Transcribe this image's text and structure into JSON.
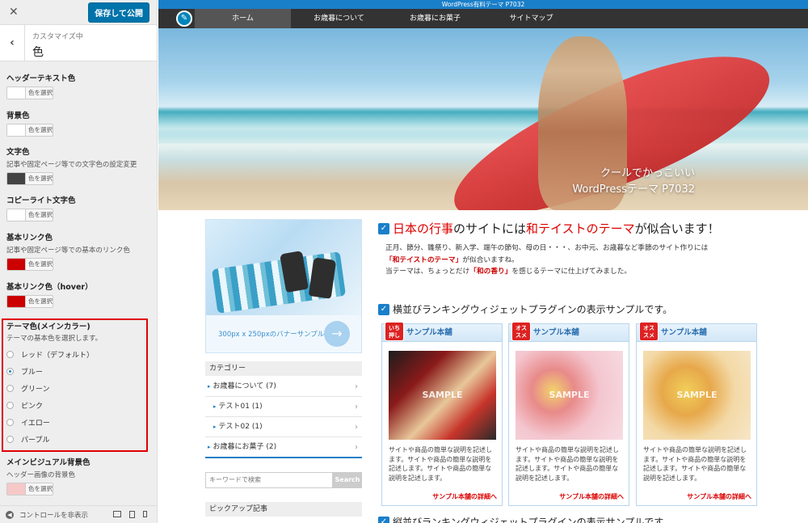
{
  "sidebar": {
    "close_icon": "close-icon",
    "save_label": "保存して公開",
    "breadcrumb": "カスタマイズ中",
    "title": "色",
    "sections": [
      {
        "label": "ヘッダーテキスト色",
        "desc": "",
        "button": "色を選択",
        "color": "#ffffff"
      },
      {
        "label": "背景色",
        "desc": "",
        "button": "色を選択",
        "color": "#ffffff"
      },
      {
        "label": "文字色",
        "desc": "記事や固定ページ等での文字色の設定変更",
        "button": "色を選択",
        "color": "#444444"
      },
      {
        "label": "コピーライト文字色",
        "desc": "",
        "button": "色を選択",
        "color": "#ffffff"
      },
      {
        "label": "基本リンク色",
        "desc": "記事や固定ページ等での基本のリンク色",
        "button": "色を選択",
        "color": "#cc0000"
      },
      {
        "label": "基本リンク色（hover）",
        "desc": "",
        "button": "色を選択",
        "color": "#cc0000"
      }
    ],
    "theme_color": {
      "label": "テーマ色(メインカラー)",
      "desc": "テーマの基本色を選択します。",
      "options": [
        "レッド（デフォルト）",
        "ブルー",
        "グリーン",
        "ピンク",
        "イエロー",
        "パープル"
      ],
      "selected": "ブルー"
    },
    "main_visual": {
      "label": "メインビジュアル背景色",
      "desc": "ヘッダー画像の背景色",
      "button": "色を選択",
      "color": "#f6c8c8"
    },
    "footer": {
      "collapse_label": "コントロールを非表示"
    }
  },
  "preview": {
    "topbar_text": "WordPress有料テーマ P7032",
    "nav": [
      "ホーム",
      "お歳暮について",
      "お歳暮にお菓子",
      "サイトマップ"
    ],
    "nav_active": "ホーム",
    "hero_caption_line1": "クールでかっこいい",
    "hero_caption_line2": "WordPressテーマ P7032",
    "banner_text": "300px x 250pxのバナーサンプル",
    "category_head": "カテゴリー",
    "categories": [
      {
        "label": "お歳暮について (7)",
        "indent": false
      },
      {
        "label": "テスト01 (1)",
        "indent": true
      },
      {
        "label": "テスト02 (1)",
        "indent": true
      },
      {
        "label": "お歳暮にお菓子 (2)",
        "indent": false
      }
    ],
    "search_placeholder": "キーワードで検索",
    "search_button": "Search",
    "pickup_head": "ピックアップ記事",
    "main_title_parts": [
      "日本の行事",
      "のサイトには",
      "和テイストのテーマ",
      "が似合います！"
    ],
    "intro_line1": "正月、節分、雛祭り、新入学、端午の節句、母の日・・・、お中元、お歳暮など季節のサイト作りには",
    "intro_line2_bold": "「和テイストのテーマ」",
    "intro_line2_rest": "が似合いますね。",
    "intro_line3_a": "当テーマは、ちょっとだけ",
    "intro_line3_bold": "「和の香り」",
    "intro_line3_b": "を感じるテーマに仕上げてみました。",
    "rank_title": "横並びランキングウィジェットプラグインの表示サンプルです。",
    "cards": [
      {
        "badge_l1": "いち",
        "badge_l2": "押し",
        "name": "サンプル本舗",
        "watermark": "SAMPLE",
        "desc": "サイトや商品の簡単な説明を記述します。サイトや商品の簡単な説明を記述します。サイトや商品の簡単な説明を記述します。",
        "more": "サンプル本舗の詳細へ"
      },
      {
        "badge_l1": "オス",
        "badge_l2": "スメ",
        "name": "サンプル本舗",
        "watermark": "SAMPLE",
        "desc": "サイトや商品の簡単な説明を記述します。サイトや商品の簡単な説明を記述します。サイトや商品の簡単な説明を記述します。",
        "more": "サンプル本舗の詳細へ"
      },
      {
        "badge_l1": "オス",
        "badge_l2": "スメ",
        "name": "サンプル本舗",
        "watermark": "SAMPLE",
        "desc": "サイトや商品の簡単な説明を記述します。サイトや商品の簡単な説明を記述します。サイトや商品の簡単な説明を記述します。",
        "more": "サンプル本舗の詳細へ"
      }
    ],
    "vert_title": "縦並びランキングウィジェットプラグインの表示サンプルです。"
  }
}
